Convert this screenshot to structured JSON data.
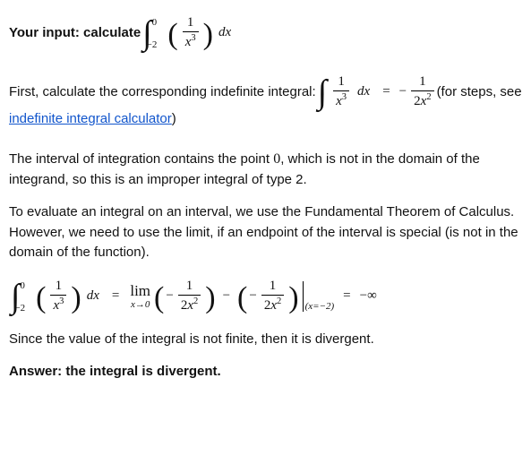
{
  "input_line": {
    "prefix": "Your input: calculate ",
    "integral": {
      "upper": "0",
      "lower": "−2",
      "frac_num": "1",
      "frac_den_base": "x",
      "frac_den_exp": "3",
      "dx": "dx"
    }
  },
  "step1": {
    "lead": "First, calculate the corresponding indefinite integral: ",
    "indef": {
      "frac_num": "1",
      "frac_den_base": "x",
      "frac_den_exp": "3",
      "dx": "dx",
      "rhs_sign": "−",
      "rhs_num": "1",
      "rhs_den_coef": "2",
      "rhs_den_base": "x",
      "rhs_den_exp": "2"
    },
    "tail1": " (for steps, see ",
    "link": "indefinite integral calculator",
    "tail2": ")"
  },
  "para_improper": "The interval of integration contains the point 0, which is not in the domain of the integrand, so this is an improper integral of type 2.",
  "para_ftc": "To evaluate an integral on an interval, we use the Fundamental Theorem of Calculus. However, we need to use the limit, if an endpoint of the interval is special (is not in the domain of the function).",
  "eval": {
    "upper": "0",
    "lower": "−2",
    "frac_num": "1",
    "frac_den_base": "x",
    "frac_den_exp": "3",
    "dx": "dx",
    "lim_label": "lim",
    "lim_sub": "x→0",
    "term_sign": "−",
    "term_num": "1",
    "term_den_coef": "2",
    "term_den_base": "x",
    "term_den_exp": "2",
    "eval_at": "(x=−2)",
    "result": "−∞"
  },
  "para_divergent": "Since the value of the integral is not finite, then it is divergent.",
  "answer": "Answer: the integral is divergent.",
  "zero_inline": "0",
  "chart_data": {
    "type": "table",
    "title": "Definite integral evaluation",
    "expression": "∫_{-2}^{0} (1/x^3) dx",
    "indefinite_integral": "∫ 1/x^3 dx = -1/(2x^2)",
    "improper_type": 2,
    "evaluation": "lim_{x→0} (-1/(2x^2)) − (-1/(2x^2))|_{x=-2} = −∞",
    "result": "divergent"
  }
}
